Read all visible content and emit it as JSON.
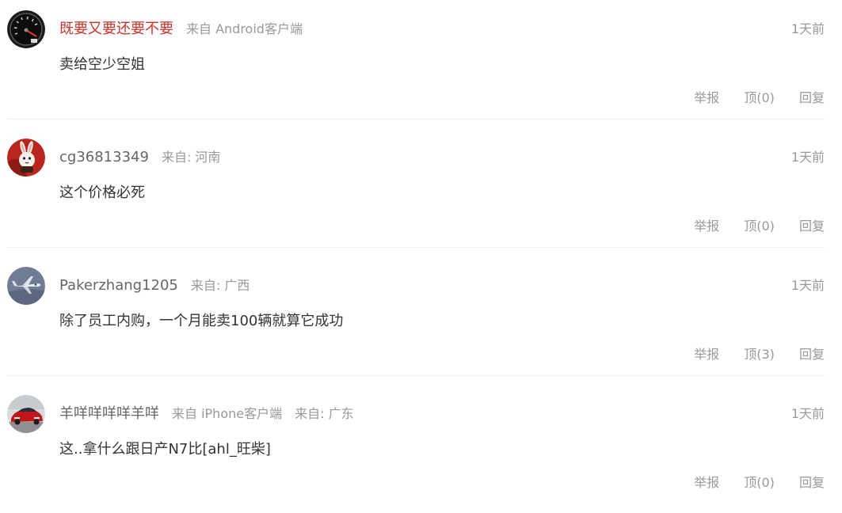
{
  "comments": [
    {
      "username": "既要又要还要不要",
      "source": "来自 Android客户端",
      "location": "",
      "time": "1天前",
      "content": "卖给空少空姐",
      "report": "举报",
      "upvote": "顶(0)",
      "reply": "回复",
      "avatar_icon": "speedometer-avatar"
    },
    {
      "username": "cg36813349",
      "source": "来自: 河南",
      "location": "",
      "time": "1天前",
      "content": "这个价格必死",
      "report": "举报",
      "upvote": "顶(0)",
      "reply": "回复",
      "avatar_icon": "rabbit-avatar"
    },
    {
      "username": "Pakerzhang1205",
      "source": "来自: 广西",
      "location": "",
      "time": "1天前",
      "content": "除了员工内购，一个月能卖100辆就算它成功",
      "report": "举报",
      "upvote": "顶(3)",
      "reply": "回复",
      "avatar_icon": "fighter-jet-avatar"
    },
    {
      "username": "羊咩咩咩咩羊咩",
      "source": "来自 iPhone客户端",
      "location": "来自: 广东",
      "time": "1天前",
      "content": "这..拿什么跟日产N7比[ahl_旺柴]",
      "report": "举报",
      "upvote": "顶(0)",
      "reply": "回复",
      "avatar_icon": "red-car-avatar"
    }
  ],
  "colors": {
    "highlight_username": "#c7352d",
    "username": "#666666",
    "muted": "#999999",
    "text": "#333333",
    "divider": "#eeeeee"
  }
}
